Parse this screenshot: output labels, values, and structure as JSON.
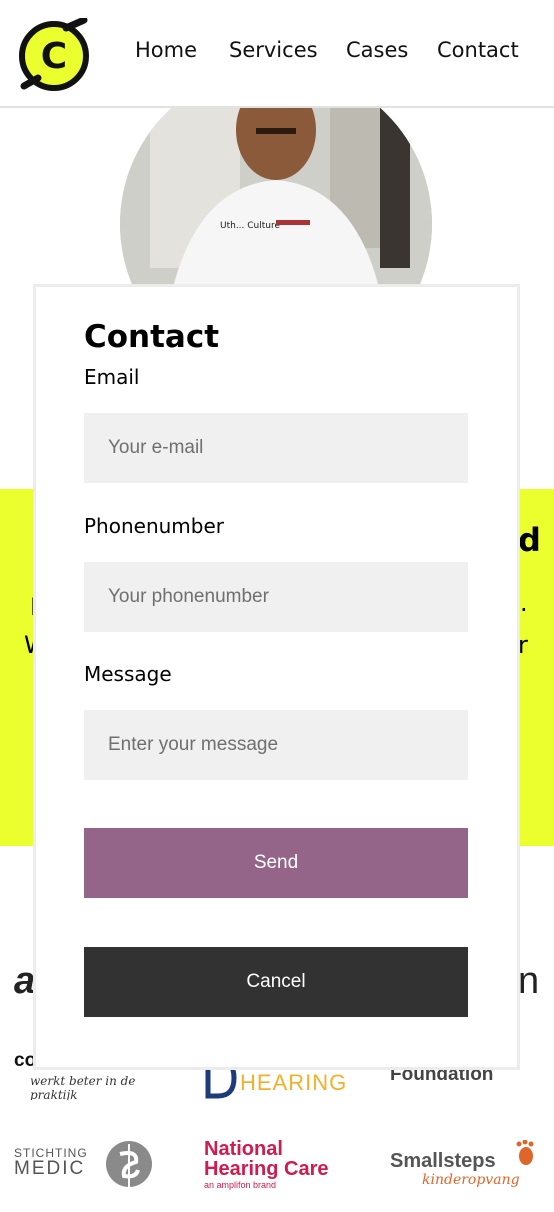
{
  "header": {
    "logo_letter": "C",
    "nav": [
      {
        "label": "Home"
      },
      {
        "label": "Services"
      },
      {
        "label": "Cases"
      },
      {
        "label": "Contact"
      }
    ]
  },
  "background": {
    "shirt_print": "Uth... Culture",
    "band_fragments": {
      "right_heading": "d",
      "left_line1": "I",
      "left_line2": "W",
      "right_line1": ".",
      "right_line2": "r"
    },
    "partners_row1": [
      "a",
      "n"
    ],
    "partners_row2": [
      {
        "name": "combitasvaes",
        "tagline": "werkt beter in de praktijk"
      },
      {
        "name": "HEARING"
      },
      {
        "name": "Foundation"
      }
    ],
    "partners_row3": [
      {
        "name_top": "STICHTING",
        "name_bottom": "MEDIC"
      },
      {
        "line1": "National",
        "line2": "Hearing Care",
        "tagline": "an amplifon brand"
      },
      {
        "name": "Smallsteps",
        "tagline": "kinderopvang"
      }
    ]
  },
  "modal": {
    "title": "Contact",
    "email": {
      "label": "Email",
      "placeholder": "Your e-mail",
      "value": ""
    },
    "phone": {
      "label": "Phonenumber",
      "placeholder": "Your phonenumber",
      "value": ""
    },
    "message": {
      "label": "Message",
      "placeholder": "Enter your message",
      "value": ""
    },
    "send_label": "Send",
    "cancel_label": "Cancel"
  },
  "colors": {
    "brand_yellow": "#eaff2d",
    "send_button": "#946489",
    "cancel_button": "#323232",
    "field_bg": "#f0f0f0"
  }
}
